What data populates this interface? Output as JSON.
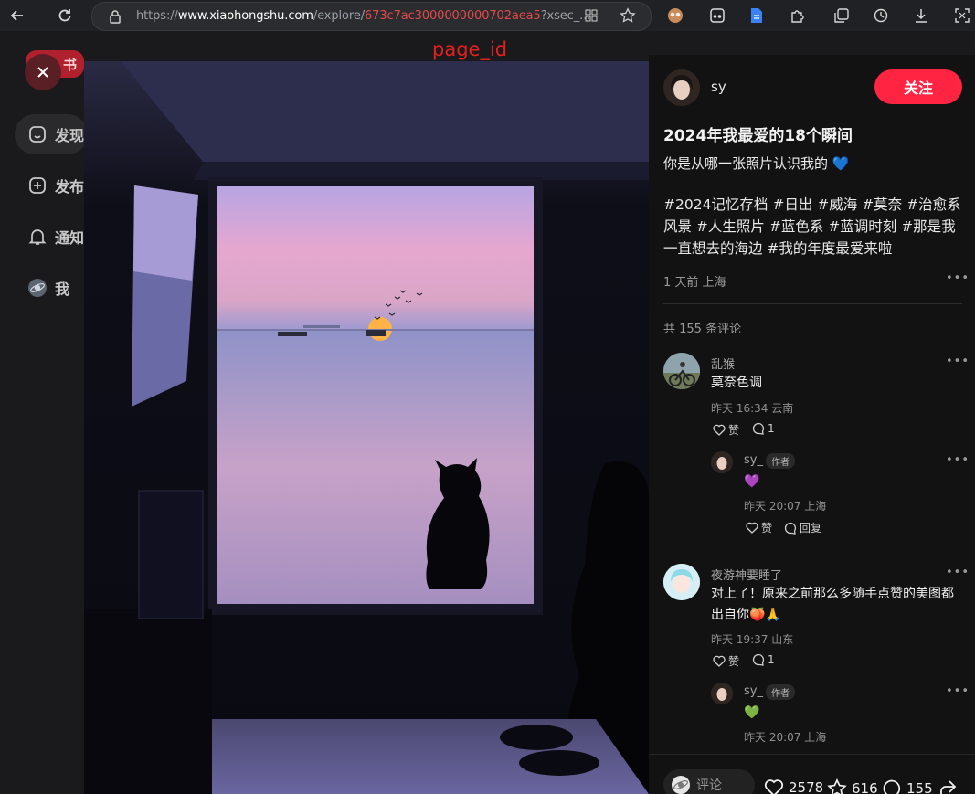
{
  "browser": {
    "url_prefix": "https://",
    "url_host": "www.xiaohongshu.com",
    "url_path": "/explore/",
    "url_id": "673c7ac3000000000702aea5",
    "url_suffix": "?xsec_...",
    "annotation_label": "page_id"
  },
  "sidebar": {
    "logo_text": "书",
    "items": [
      {
        "label": "发现",
        "icon": "home-icon"
      },
      {
        "label": "发布",
        "icon": "plus-square-icon"
      },
      {
        "label": "通知",
        "icon": "bell-icon"
      },
      {
        "label": "我",
        "icon": "user-avatar-icon"
      }
    ]
  },
  "note": {
    "author": "sy",
    "follow_label": "关注",
    "title": "2024年我最爱的18个瞬间",
    "description": "你是从哪一张照片认识我的 💙",
    "tags": "#2024记忆存档 #日出 #威海 #莫奈 #治愈系风景 #人生照片 #蓝色系 #蓝调时刻 #那是我一直想去的海边 #我的年度最爱来啦",
    "meta": "1 天前 上海",
    "comment_count_text": "共 155 条评论"
  },
  "comments": [
    {
      "name": "乱猴",
      "text": "莫奈色调",
      "time": "昨天 16:34 云南",
      "like_label": "赞",
      "reply_count": "1",
      "reply": {
        "name": "sy_",
        "badge": "作者",
        "text": "💜",
        "time": "昨天 20:07 上海",
        "like_label": "赞",
        "reply_label": "回复"
      }
    },
    {
      "name": "夜游神要睡了",
      "text_line1": "对上了！原来之前那么多随手点赞的美图都",
      "text_line2": "出自你🍑🙏",
      "time": "昨天 19:37 山东",
      "like_label": "赞",
      "reply_count": "1",
      "reply": {
        "name": "sy_",
        "badge": "作者",
        "text": "💚",
        "time": "昨天 20:07 上海"
      }
    }
  ],
  "engagement": {
    "comment_placeholder": "评论",
    "likes": "2578",
    "stars": "616",
    "comments": "155"
  },
  "colors": {
    "follow_button": "#ff2442",
    "panel_background": "#121212"
  },
  "photo": {
    "subject": "window-with-cat-silhouette-at-sunset-sea",
    "sky_top": "#c9a3e0",
    "sky_mid": "#e9a6c6",
    "sea": "#9b95c8",
    "interior": "#0b0b12"
  }
}
